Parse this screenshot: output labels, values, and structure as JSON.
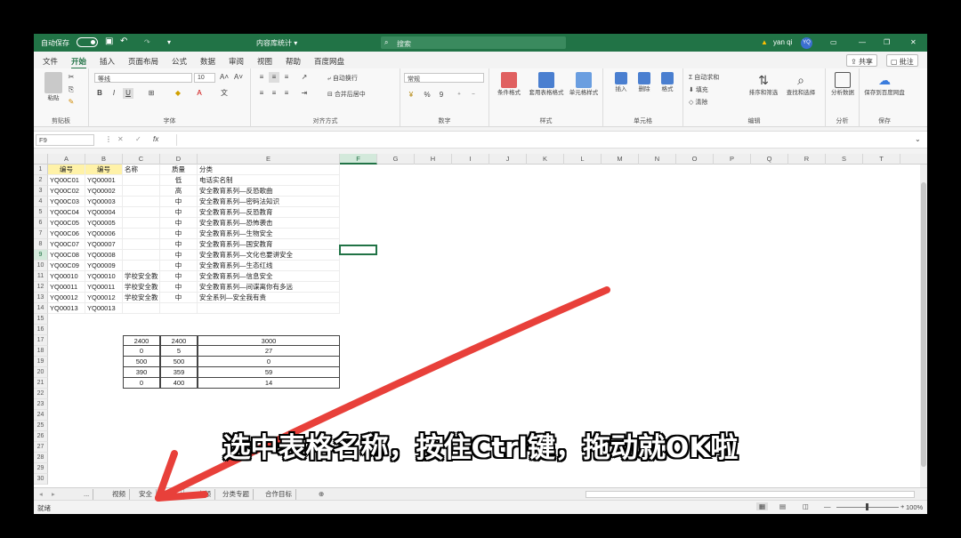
{
  "titlebar": {
    "autosave": "自动保存",
    "doc_title": "内容库统计 ▾",
    "search_placeholder": "搜索",
    "warning": "▲",
    "user": "yan qi",
    "user_initials": "YQ"
  },
  "menu": {
    "tabs": [
      "文件",
      "开始",
      "插入",
      "页面布局",
      "公式",
      "数据",
      "审阅",
      "视图",
      "帮助",
      "百度网盘"
    ],
    "active": "开始",
    "share": "共享",
    "comments": "批注"
  },
  "ribbon": {
    "clipboard": {
      "label": "剪贴板",
      "paste": "粘贴"
    },
    "font": {
      "label": "字体",
      "name": "等线",
      "size": "10"
    },
    "align": {
      "label": "对齐方式",
      "wrap": "自动换行",
      "merge": "合并后居中"
    },
    "number": {
      "label": "数字",
      "format": "常规"
    },
    "styles": {
      "label": "样式",
      "items": [
        "条件格式",
        "套用表格格式",
        "单元格样式"
      ]
    },
    "cells": {
      "label": "单元格",
      "items": [
        "插入",
        "删除",
        "格式"
      ]
    },
    "editing": {
      "label": "编辑",
      "autosum": "自动求和",
      "fill": "填充",
      "clear": "清除",
      "sort": "排序和筛选",
      "find": "查找和选择"
    },
    "analysis": {
      "label": "分析",
      "btn": "分析数据"
    },
    "save": {
      "label": "保存",
      "btn": "保存到百度网盘"
    }
  },
  "formula_bar": {
    "namebox": "F9",
    "fx": "fx",
    "value": ""
  },
  "columns": [
    "A",
    "B",
    "C",
    "D",
    "E",
    "F",
    "G",
    "H",
    "I",
    "J",
    "K",
    "L",
    "M",
    "N",
    "O",
    "P",
    "Q",
    "R",
    "S",
    "T"
  ],
  "selected_col": "F",
  "selected_row": 9,
  "sheet_rows": [
    {
      "n": 1,
      "A": "编号",
      "B": "编号",
      "C": "名称",
      "D": "质量",
      "E": "分类"
    },
    {
      "n": 2,
      "A": "YQ00C01",
      "B": "YQ00001",
      "C": "",
      "D": "低",
      "E": "电话实名制"
    },
    {
      "n": 3,
      "A": "YQ00C02",
      "B": "YQ00002",
      "C": "",
      "D": "高",
      "E": "安全教育系列—反恐歌曲"
    },
    {
      "n": 4,
      "A": "YQ00C03",
      "B": "YQ00003",
      "C": "",
      "D": "中",
      "E": "安全教育系列—密码法知识"
    },
    {
      "n": 5,
      "A": "YQ00C04",
      "B": "YQ00004",
      "C": "",
      "D": "中",
      "E": "安全教育系列—反恐教育"
    },
    {
      "n": 6,
      "A": "YQ00C05",
      "B": "YQ00005",
      "C": "",
      "D": "中",
      "E": "安全教育系列—恐怖袭击"
    },
    {
      "n": 7,
      "A": "YQ00C06",
      "B": "YQ00006",
      "C": "",
      "D": "中",
      "E": "安全教育系列—生物安全"
    },
    {
      "n": 8,
      "A": "YQ00C07",
      "B": "YQ00007",
      "C": "",
      "D": "中",
      "E": "安全教育系列—国安教育"
    },
    {
      "n": 9,
      "A": "YQ00C08",
      "B": "YQ00008",
      "C": "",
      "D": "中",
      "E": "安全教育系列—文化也要讲安全"
    },
    {
      "n": 10,
      "A": "YQ00C09",
      "B": "YQ00009",
      "C": "",
      "D": "中",
      "E": "安全教育系列—生态红线"
    },
    {
      "n": 11,
      "A": "YQ00010",
      "B": "YQ00010",
      "C": "学校安全教",
      "D": "中",
      "E": "安全教育系列—信息安全"
    },
    {
      "n": 12,
      "A": "YQ00011",
      "B": "YQ00011",
      "C": "学校安全教",
      "D": "中",
      "E": "安全教育系列—间谍离你有多远"
    },
    {
      "n": 13,
      "A": "YQ00012",
      "B": "YQ00012",
      "C": "学校安全教",
      "D": "中",
      "E": "安全系列—安全我有责"
    },
    {
      "n": 14,
      "A": "YQ00013",
      "B": "YQ00013",
      "C": "",
      "D": "",
      "E": ""
    }
  ],
  "summary_table": [
    {
      "n": 17,
      "C": "2400",
      "D": "2400",
      "E": "3000"
    },
    {
      "n": 18,
      "C": "0",
      "D": "5",
      "E": "27"
    },
    {
      "n": 19,
      "C": "500",
      "D": "500",
      "E": "0"
    },
    {
      "n": 20,
      "C": "390",
      "D": "359",
      "E": "59"
    },
    {
      "n": 21,
      "C": "0",
      "D": "400",
      "E": "14"
    }
  ],
  "total_rows": 30,
  "sheet_tabs": [
    "...",
    "视频",
    "安全",
    "国防",
    "",
    "音频",
    "分类专题",
    "合作目标"
  ],
  "active_sheet": "国防",
  "status": {
    "ready": "就绪",
    "zoom": "100%"
  },
  "caption": "选中表格名称，按住Ctrl键，拖动就OK啦",
  "colors": {
    "excel_green": "#217346",
    "arrow_red": "#e8403a",
    "header_yellow": "#fff2a8"
  }
}
